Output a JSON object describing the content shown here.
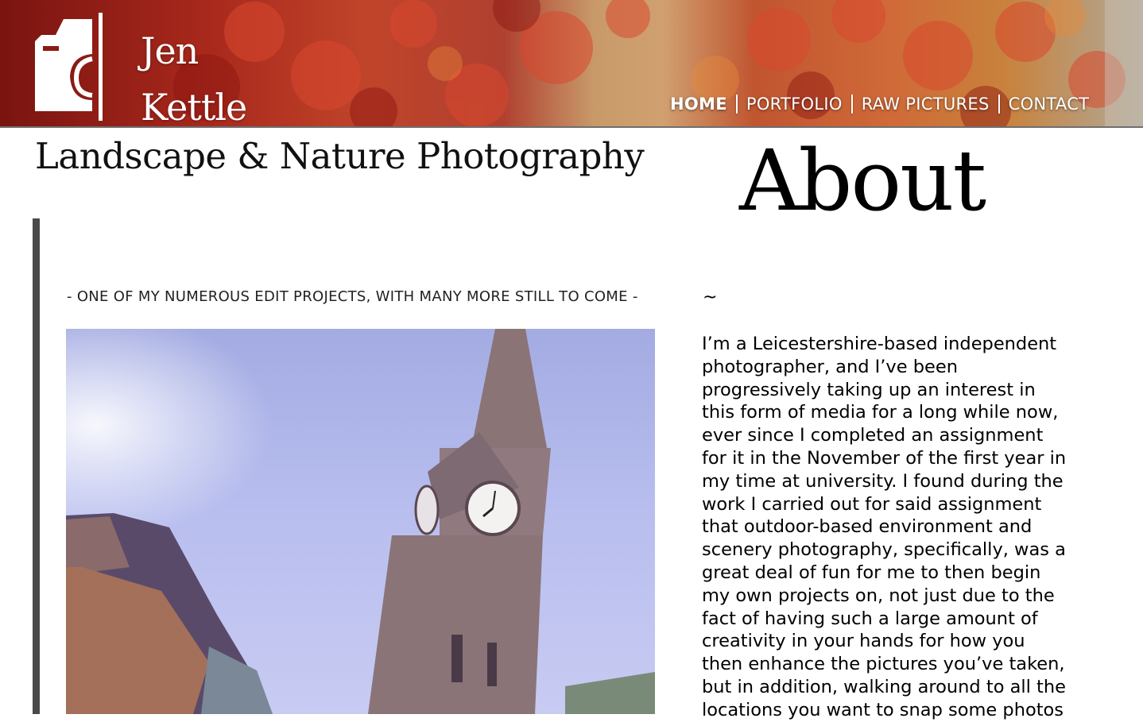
{
  "brand": {
    "name_line1": "Jen",
    "name_line2": "Kettle",
    "logo_icon": "camera-icon"
  },
  "nav": {
    "items": [
      {
        "label": "HOME",
        "active": true
      },
      {
        "label": "PORTFOLIO",
        "active": false
      },
      {
        "label": "RAW PICTURES",
        "active": false
      },
      {
        "label": "CONTACT",
        "active": false
      }
    ]
  },
  "main": {
    "subtitle": "Landscape & Nature Photography",
    "caption": "- ONE OF MY NUMEROUS EDIT PROJECTS, WITH MANY MORE STILL TO COME -"
  },
  "about": {
    "title": "About",
    "separator": "~",
    "body": "I’m a Leicestershire-based independent\nphotographer, and I’ve been\nprogressively taking up an interest in\nthis form of media for a long while now,\never since I completed an assignment\nfor it in the November of the first year in\nmy time at university. I found during the\nwork I carried out for said assignment\nthat outdoor-based environment and\nscenery photography, specifically, was a\ngreat deal of fun for me to then begin\nmy own projects on, not just due to the\nfact of having such a large amount of\ncreativity in your hands for how you\nthen enhance the pictures you’ve taken,\nbut in addition, walking around to all the\nlocations you want to snap some photos"
  },
  "colors": {
    "accent_bar": "#4a4a4a",
    "nav_text": "#ffffff",
    "header_red": "#b0301f"
  }
}
